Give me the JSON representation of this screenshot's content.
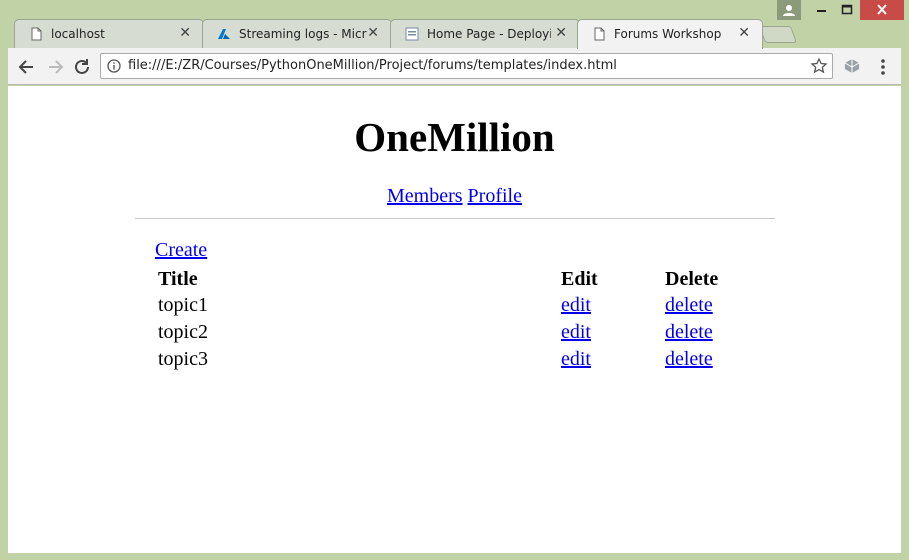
{
  "browser": {
    "tabs": [
      {
        "title": "localhost",
        "icon": "page-icon",
        "close": "✕"
      },
      {
        "title": "Streaming logs - Micro",
        "icon": "azure-icon",
        "close": "✕"
      },
      {
        "title": "Home Page - Deployin",
        "icon": "doc-icon",
        "close": "✕"
      },
      {
        "title": "Forums Workshop",
        "icon": "page-icon",
        "close": "✕",
        "active": true
      }
    ],
    "address": "file:///E:/ZR/Courses/PythonOneMillion/Project/forums/templates/index.html"
  },
  "page": {
    "site_title": "OneMillion",
    "nav": {
      "members": "Members",
      "profile": "Profile"
    },
    "create_label": "Create",
    "table": {
      "headers": {
        "title": "Title",
        "edit": "Edit",
        "delete": "Delete"
      },
      "rows": [
        {
          "title": "topic1",
          "edit": "edit",
          "delete": "delete"
        },
        {
          "title": "topic2",
          "edit": "edit",
          "delete": "delete"
        },
        {
          "title": "topic3",
          "edit": "edit",
          "delete": "delete"
        }
      ]
    }
  },
  "colors": {
    "link": "#0000ee",
    "frame": "#c1d3a6",
    "close_button": "#c94b47"
  }
}
